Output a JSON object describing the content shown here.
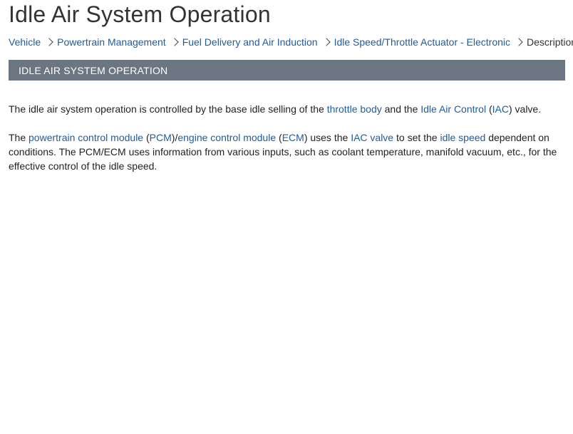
{
  "page": {
    "title": "Idle Air System Operation"
  },
  "breadcrumb": {
    "items": [
      "Vehicle",
      "Powertrain Management",
      "Fuel Delivery and Air Induction",
      "Idle Speed/Throttle Actuator - Electronic"
    ],
    "current": "Description"
  },
  "section": {
    "header": "IDLE AIR SYSTEM OPERATION"
  },
  "paragraph1": {
    "t1": "The idle air system operation is controlled by the base idle selling of the ",
    "link_throttle_body": "throttle body",
    "t2": " and the ",
    "link_idle_air_control": "Idle Air Control",
    "t3": " (",
    "link_iac": "IAC",
    "t4": ") valve."
  },
  "paragraph2": {
    "t1": "The ",
    "link_pcm": "powertrain control module",
    "t2": " (",
    "link_pcm_abbr": "PCM",
    "t3": ")/",
    "link_ecm": "engine control module",
    "t4": " (",
    "link_ecm_abbr": "ECM",
    "t5": ") uses the ",
    "link_iac_valve": "IAC valve",
    "t6": " to set the ",
    "link_idle_speed": "idle speed",
    "t7": " dependent on conditions. The PCM/ECM uses information from various inputs, such as coolant temperature, manifold vacuum, etc., for the effective control of the idle speed."
  },
  "colors": {
    "link": "#1f5b9e",
    "header_bg": "#6c7683",
    "header_text": "#ffffff",
    "title": "#333333"
  }
}
